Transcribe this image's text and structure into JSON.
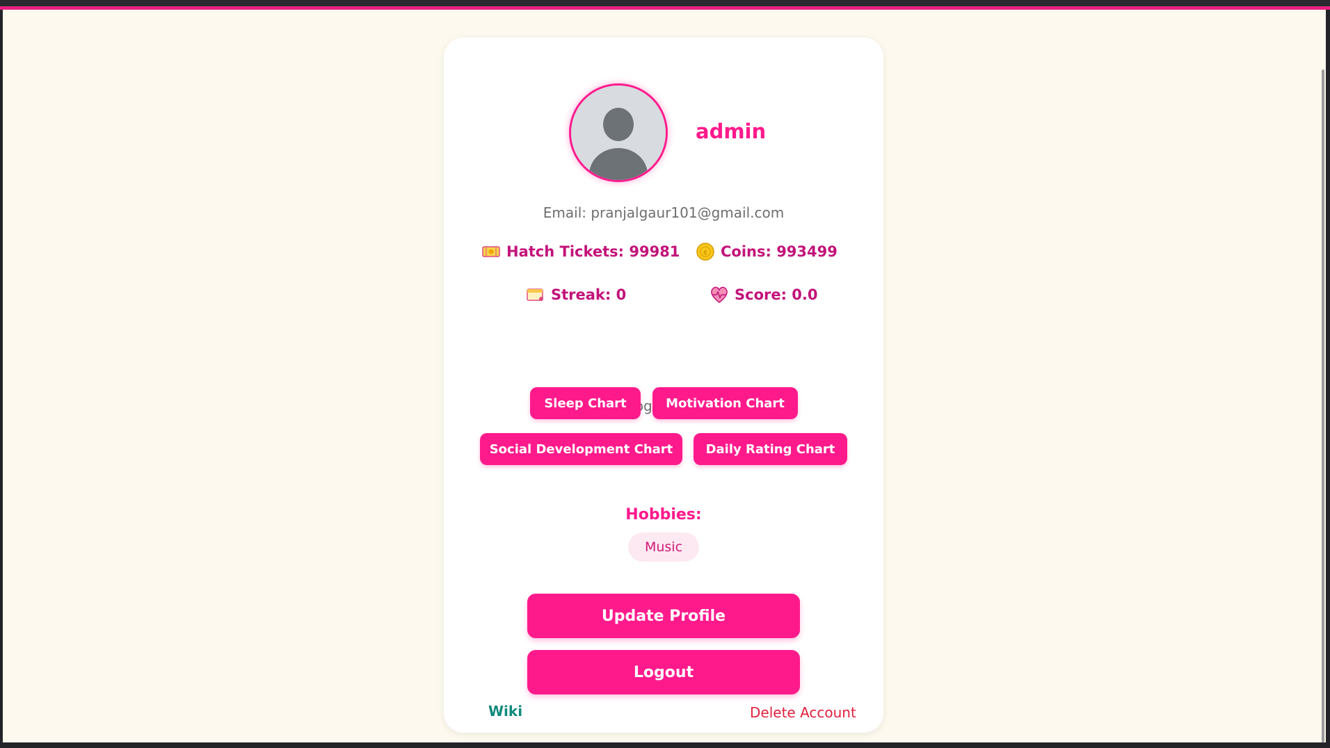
{
  "profile": {
    "username": "admin",
    "email": "Email: pranjalgaur101@gmail.com"
  },
  "stats": {
    "hatch_tickets": {
      "label": "Hatch Tickets: 99981",
      "icon": "ticket-icon"
    },
    "coins": {
      "label": "Coins: 993499",
      "icon": "coin-icon"
    },
    "streak": {
      "label": "Streak: 0",
      "icon": "calendar-icon"
    },
    "score": {
      "label": "Score: 0.0",
      "icon": "heartbeat-icon"
    }
  },
  "charts": {
    "prompt": "View your progress charts below!",
    "buttons": [
      "Sleep Chart",
      "Motivation Chart",
      "Social Development Chart",
      "Daily Rating Chart"
    ]
  },
  "hobbies": {
    "title": "Hobbies:",
    "items": [
      "Music"
    ]
  },
  "actions": {
    "update_profile": "Update Profile",
    "logout": "Logout"
  },
  "footer": {
    "wiki": "Wiki",
    "delete_account": "Delete Account"
  },
  "colors": {
    "accent": "#ff1a8c",
    "stat_text": "#c2137a",
    "background": "#fdf9ee",
    "link_green": "#0e8a7d",
    "danger": "#e0213e"
  }
}
